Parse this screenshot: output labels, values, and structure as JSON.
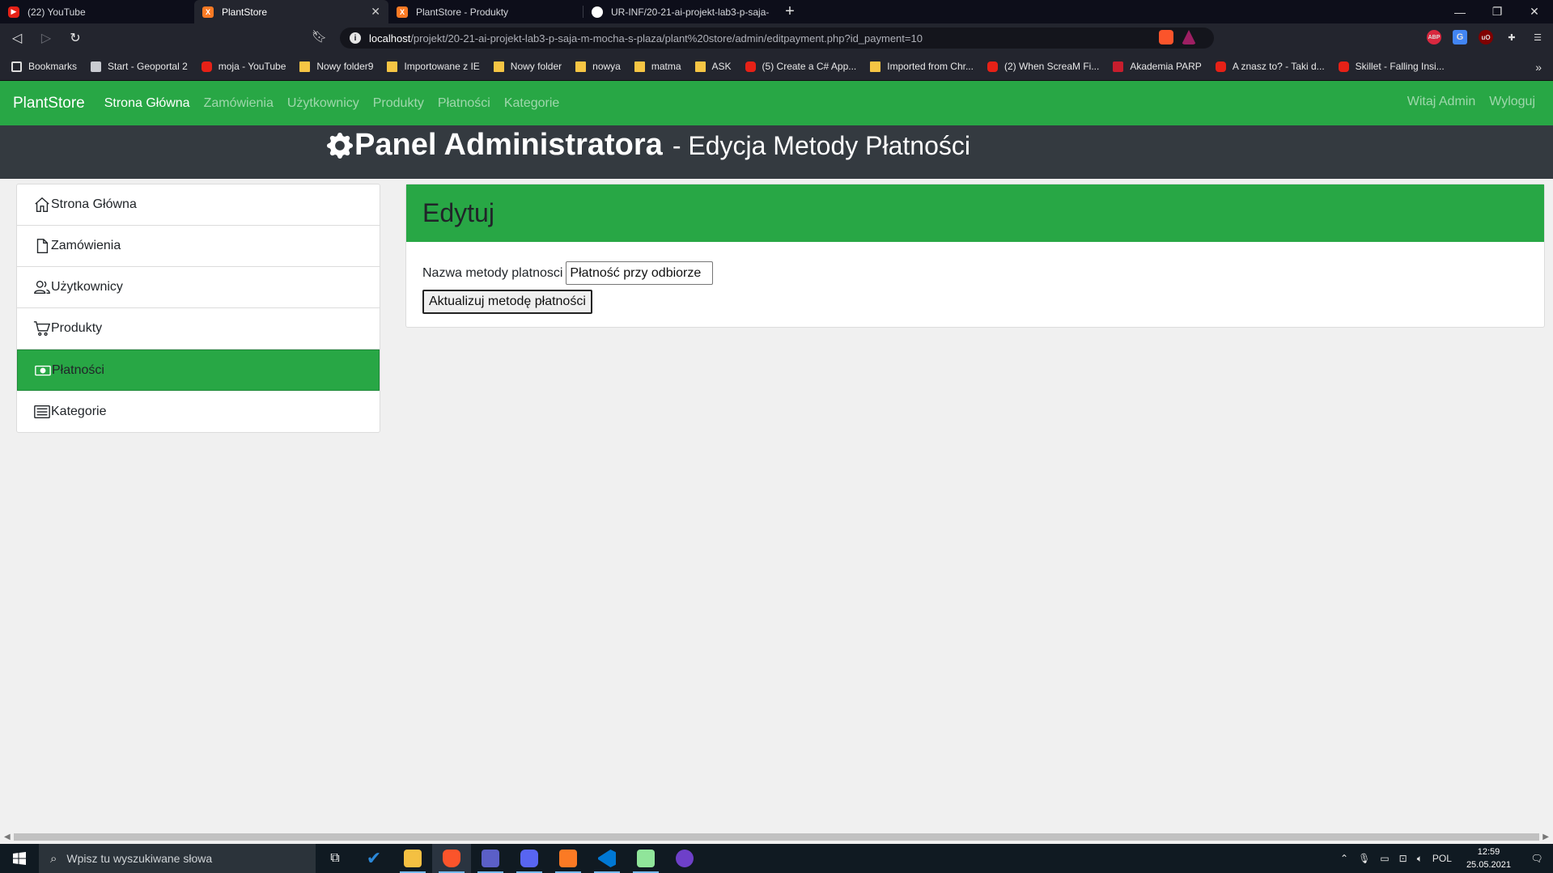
{
  "browser": {
    "tabs": [
      {
        "title": "(22) YouTube",
        "icon": "youtube-icon"
      },
      {
        "title": "PlantStore",
        "icon": "xampp-icon",
        "active": true
      },
      {
        "title": "PlantStore - Produkty",
        "icon": "xampp-icon"
      },
      {
        "title": "UR-INF/20-21-ai-projekt-lab3-p-saja-",
        "icon": "github-icon"
      }
    ],
    "url_host": "localhost",
    "url_path": "/projekt/20-21-ai-projekt-lab3-p-saja-m-mocha-s-plaza/plant%20store/admin/editpayment.php?id_payment=10",
    "bookmarks_label": "Bookmarks",
    "bookmarks": [
      {
        "label": "Start - Geoportal 2",
        "icon": "page"
      },
      {
        "label": "moja - YouTube",
        "icon": "yt"
      },
      {
        "label": "Nowy folder9",
        "icon": "folder"
      },
      {
        "label": "Importowane z IE",
        "icon": "folder"
      },
      {
        "label": "Nowy folder",
        "icon": "folder"
      },
      {
        "label": "nowya",
        "icon": "folder"
      },
      {
        "label": "matma",
        "icon": "folder"
      },
      {
        "label": "ASK",
        "icon": "folder"
      },
      {
        "label": "(5) Create a C# App...",
        "icon": "yt"
      },
      {
        "label": "Imported from Chr...",
        "icon": "folder"
      },
      {
        "label": "(2) When ScreaM Fi...",
        "icon": "yt"
      },
      {
        "label": "Akademia PARP",
        "icon": "parp"
      },
      {
        "label": "A znasz to? - Taki d...",
        "icon": "yt"
      },
      {
        "label": "Skillet - Falling Insi...",
        "icon": "yt"
      }
    ],
    "more_bookmarks": "»"
  },
  "navbar": {
    "brand": "PlantStore",
    "links": [
      "Strona Główna",
      "Zamówienia",
      "Użytkownicy",
      "Produkty",
      "Płatności",
      "Kategorie"
    ],
    "welcome": "Witaj Admin",
    "logout": "Wyloguj"
  },
  "header": {
    "title": "Panel Administratora",
    "subtitle": "- Edycja Metody Płatności"
  },
  "sidebar": {
    "items": [
      {
        "label": "Strona Główna",
        "icon": "house-icon"
      },
      {
        "label": "Zamówienia",
        "icon": "file-icon"
      },
      {
        "label": "Użytkownicy",
        "icon": "users-icon"
      },
      {
        "label": "Produkty",
        "icon": "cart-icon"
      },
      {
        "label": "Płatności",
        "icon": "cash-icon",
        "active": true
      },
      {
        "label": "Kategorie",
        "icon": "list-icon"
      }
    ]
  },
  "card": {
    "title": "Edytuj",
    "field_label": "Nazwa metody platnosci",
    "field_value": "Płatność przy odbiorze",
    "submit_label": "Aktualizuj metodę płatności"
  },
  "taskbar": {
    "search_placeholder": "Wpisz tu wyszukiwane słowa",
    "language": "POL",
    "time": "12:59",
    "date": "25.05.2021"
  },
  "colors": {
    "green": "#28a745",
    "dark": "#343a40",
    "chrome": "#23252e"
  }
}
